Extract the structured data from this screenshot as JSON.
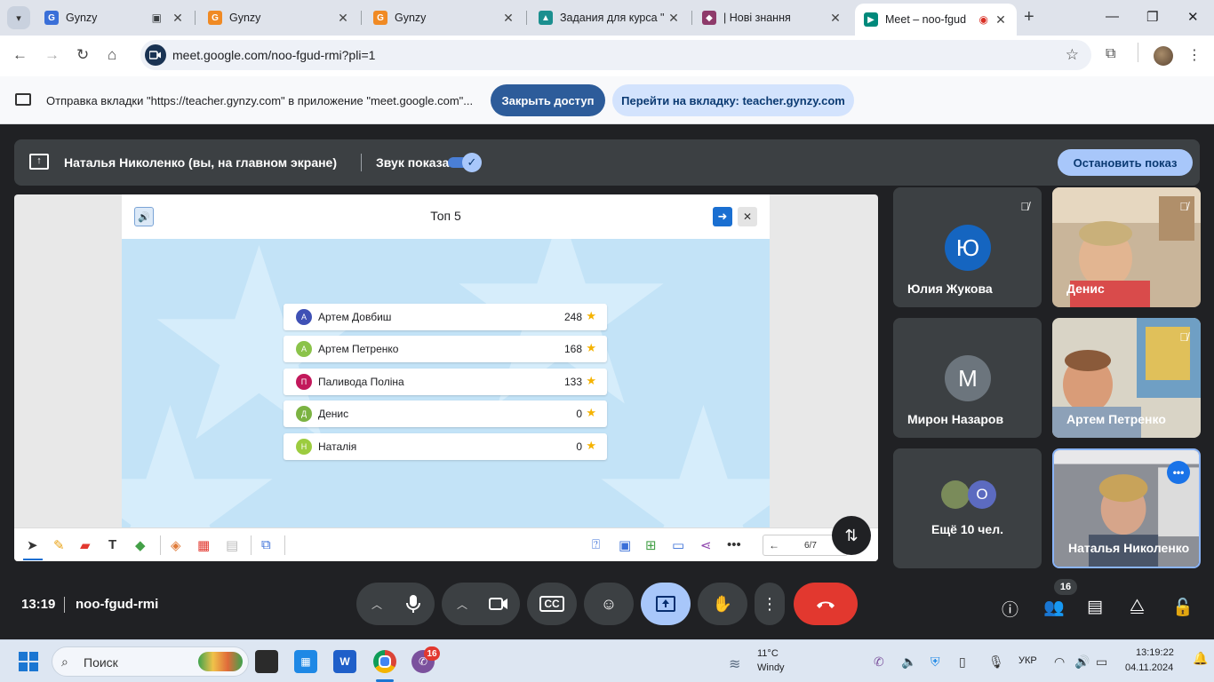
{
  "browser": {
    "tabs": [
      {
        "title": "Gynzy",
        "favicon": "G",
        "color": "#3a6fd8"
      },
      {
        "title": "Gynzy",
        "favicon": "G",
        "color": "#f08a24"
      },
      {
        "title": "Gynzy",
        "favicon": "G",
        "color": "#f08a24"
      },
      {
        "title": "Задания для курса \"",
        "favicon": "▲",
        "color": "#1b8f8f"
      },
      {
        "title": "| Нові знання",
        "favicon": "◆",
        "color": "#8e3a6a"
      },
      {
        "title": "Meet – noo-fgud",
        "favicon": "▶",
        "color": "#00897b"
      }
    ],
    "url": "meet.google.com/noo-fgud-rmi?pli=1"
  },
  "infobar": {
    "text": "Отправка вкладки \"https://teacher.gynzy.com\" в приложение \"meet.google.com\"...",
    "stop_access": "Закрыть доступ",
    "goto_tab": "Перейти на вкладку: teacher.gynzy.com"
  },
  "presenting": {
    "name": "Наталья Николенко (вы, на главном экране)",
    "sound_label": "Звук показа",
    "stop_button": "Остановить показ"
  },
  "gynzy": {
    "title": "Топ 5",
    "leaderboard": [
      {
        "initial": "А",
        "name": "Артем Довбиш",
        "score": "248",
        "color": "#3f51b5"
      },
      {
        "initial": "А",
        "name": "Артем Петренко",
        "score": "168",
        "color": "#8bc34a"
      },
      {
        "initial": "П",
        "name": "Паливода Поліна",
        "score": "133",
        "color": "#c2185b"
      },
      {
        "initial": "Д",
        "name": "Денис",
        "score": "0",
        "color": "#7cb342"
      },
      {
        "initial": "Н",
        "name": "Наталія",
        "score": "0",
        "color": "#9ccc3f"
      }
    ],
    "page_indicator": "6/7"
  },
  "participants": [
    {
      "name": "Юлия Жукова",
      "initial": "Ю",
      "color": "#1565c0",
      "muted": true
    },
    {
      "name": "Денис",
      "muted": true
    },
    {
      "name": "Мирон Назаров",
      "initial": "М",
      "color": "#6c757d",
      "muted": false
    },
    {
      "name": "Артем Петренко",
      "muted": true
    },
    {
      "name": "Ещё 10 чел.",
      "initial": "О",
      "color": "#5c6bc0"
    },
    {
      "name": "Наталья Николенко"
    }
  ],
  "meeting": {
    "time": "13:19",
    "code": "noo-fgud-rmi",
    "participant_count": "16"
  },
  "taskbar": {
    "search_label": "Поиск",
    "viber_badge": "16",
    "weather_temp": "11°C",
    "weather_desc": "Windy",
    "language": "УКР",
    "clock_time": "13:19:22",
    "clock_date": "04.11.2024"
  }
}
